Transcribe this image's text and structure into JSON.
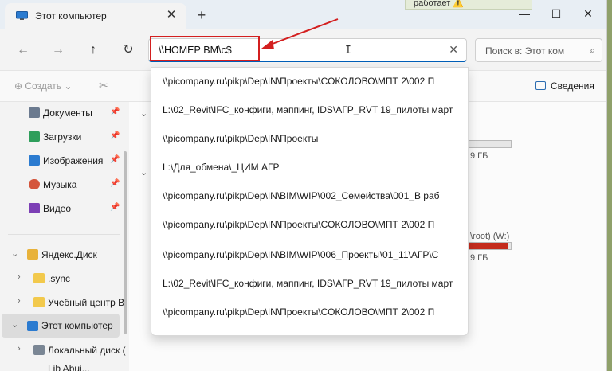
{
  "window": {
    "tab_title": "Этот компьютер",
    "notification_text": "работает ⚠️"
  },
  "nav": {
    "address_value": "\\\\НОМЕР ВМ\\c$",
    "search_placeholder": "Поиск в: Этот ком"
  },
  "commandbar": {
    "create_label": "Создать",
    "details_label": "Сведения"
  },
  "sidebar": {
    "pinned": [
      {
        "label": "Документы",
        "icon": "document-icon",
        "color": "#6b7a8f"
      },
      {
        "label": "Загрузки",
        "icon": "download-icon",
        "color": "#2e9e5b"
      },
      {
        "label": "Изображения",
        "icon": "picture-icon",
        "color": "#2b7bd0"
      },
      {
        "label": "Музыка",
        "icon": "music-icon",
        "color": "#d4553c"
      },
      {
        "label": "Видео",
        "icon": "video-icon",
        "color": "#7c3fb5"
      }
    ],
    "yandex_disk": "Яндекс.Диск",
    "yandex_children": [
      ".sync",
      "Учебный центр BI"
    ],
    "this_pc": "Этот компьютер",
    "local_disk": "Локальный диск (",
    "partial_item": "Lib Abui..."
  },
  "main": {
    "size_text_1": "9 ГБ",
    "size_text_2": "9 ГБ",
    "root_drive_label": "\\root) (W:)",
    "root_drive_fill_pct": 92
  },
  "dropdown": {
    "items": [
      "\\\\picompany.ru\\pikp\\Dep\\IN\\Проекты\\СОКОЛОВО\\МПТ 2\\002 П",
      "L:\\02_Revit\\IFC_конфиги, маппинг, IDS\\АГР_RVT 19_пилоты март",
      "\\\\picompany.ru\\pikp\\Dep\\IN\\Проекты",
      "L:\\Для_обмена\\_ЦИМ АГР",
      "\\\\picompany.ru\\pikp\\Dep\\IN\\BIM\\WIP\\002_Семейства\\001_В раб",
      "\\\\picompany.ru\\pikp\\Dep\\IN\\Проекты\\СОКОЛОВО\\МПТ 2\\002 П",
      "\\\\picompany.ru\\pikp\\Dep\\IN\\BIM\\WIP\\006_Проекты\\01_11\\АГР\\С",
      "L:\\02_Revit\\IFC_конфиги, маппинг, IDS\\АГР_RVT 19_пилоты март",
      "\\\\picompany.ru\\pikp\\Dep\\IN\\Проекты\\СОКОЛОВО\\МПТ 2\\002 П"
    ]
  },
  "colors": {
    "highlight": "#d31f1f",
    "accent": "#005fb8"
  }
}
